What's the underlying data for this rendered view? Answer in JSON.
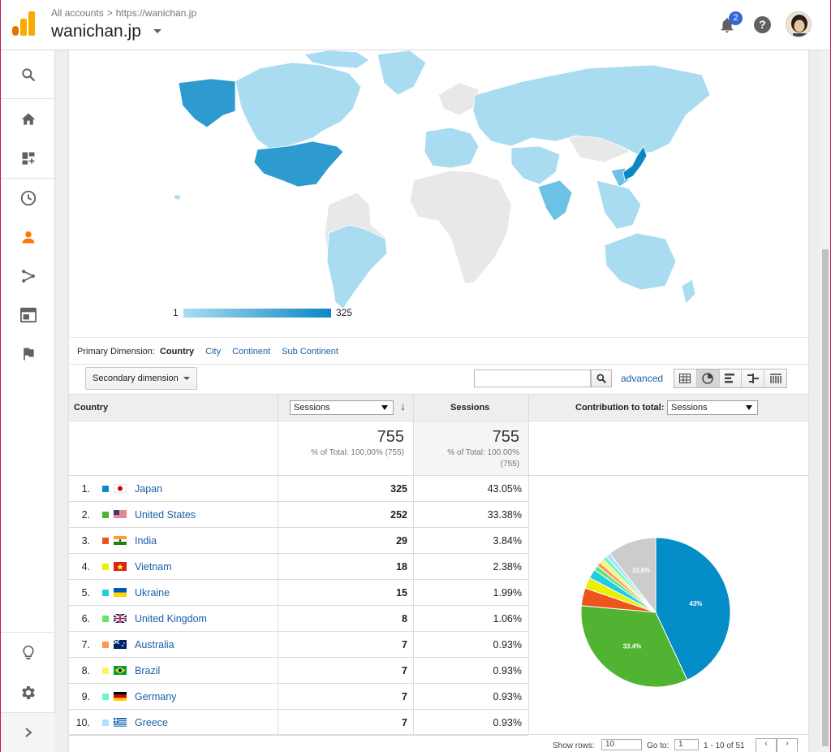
{
  "header": {
    "breadcrumb_accounts": "All accounts",
    "breadcrumb_sep": ">",
    "breadcrumb_url": "https://wanichan.jp",
    "site_title": "wanichan.jp",
    "notification_count": "2",
    "help_glyph": "?"
  },
  "nav": {
    "icons": [
      "search-icon",
      "home-icon",
      "customization-icon",
      "realtime-clock-icon",
      "audience-person-icon",
      "acquisition-icon",
      "behavior-icon",
      "conversions-flag-icon",
      "discover-bulb-icon",
      "admin-gear-icon",
      "expand-chevron-icon"
    ],
    "active_color": "#f57c00"
  },
  "map": {
    "legend_min": "1",
    "legend_max": "325",
    "color_low": "#aadcf1",
    "color_high": "#0a88c4"
  },
  "dimension": {
    "label": "Primary Dimension:",
    "active": "Country",
    "options": [
      "City",
      "Continent",
      "Sub Continent"
    ]
  },
  "controls": {
    "secondary_dimension": "Secondary dimension",
    "advanced": "advanced"
  },
  "table": {
    "col_country": "Country",
    "metric_select": "Sessions",
    "col_sessions": "Sessions",
    "contribution_label": "Contribution to total:",
    "contribution_select": "Sessions",
    "totals": {
      "value1": "755",
      "pct1": "% of Total: 100.00% (755)",
      "value2": "755",
      "pct2_line1": "% of Total: 100.00%",
      "pct2_line2": "(755)"
    },
    "rows": [
      {
        "idx": "1.",
        "country": "Japan",
        "sessions": "325",
        "pct": "43.05%",
        "color": "#058dc7"
      },
      {
        "idx": "2.",
        "country": "United States",
        "sessions": "252",
        "pct": "33.38%",
        "color": "#50b432"
      },
      {
        "idx": "3.",
        "country": "India",
        "sessions": "29",
        "pct": "3.84%",
        "color": "#ed561b"
      },
      {
        "idx": "4.",
        "country": "Vietnam",
        "sessions": "18",
        "pct": "2.38%",
        "color": "#edef00"
      },
      {
        "idx": "5.",
        "country": "Ukraine",
        "sessions": "15",
        "pct": "1.99%",
        "color": "#24cbe5"
      },
      {
        "idx": "6.",
        "country": "United Kingdom",
        "sessions": "8",
        "pct": "1.06%",
        "color": "#64e572"
      },
      {
        "idx": "7.",
        "country": "Australia",
        "sessions": "7",
        "pct": "0.93%",
        "color": "#ff9655"
      },
      {
        "idx": "8.",
        "country": "Brazil",
        "sessions": "7",
        "pct": "0.93%",
        "color": "#fff263"
      },
      {
        "idx": "9.",
        "country": "Germany",
        "sessions": "7",
        "pct": "0.93%",
        "color": "#6af9c4"
      },
      {
        "idx": "10.",
        "country": "Greece",
        "sessions": "7",
        "pct": "0.93%",
        "color": "#b2deff"
      }
    ]
  },
  "pie": {
    "labels": {
      "japan": "43%",
      "us": "33.4%",
      "other": "10.0%"
    },
    "other_color": "#cccccc"
  },
  "footer": {
    "show_rows": "Show rows:",
    "show_rows_value": "10",
    "goto": "Go to:",
    "goto_value": "1",
    "range": "1 - 10 of 51"
  }
}
